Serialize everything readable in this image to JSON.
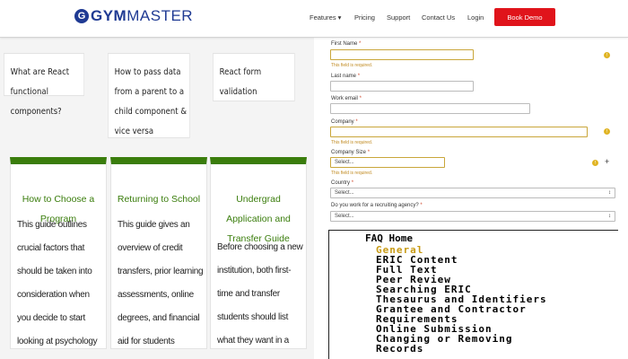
{
  "header": {
    "logo_gym": "GYM",
    "logo_master": "MASTER",
    "nav": {
      "features": "Features ▾",
      "pricing": "Pricing",
      "support": "Support",
      "contact": "Contact Us",
      "login": "Login"
    },
    "book_demo": "Book Demo",
    "colors": {
      "brand": "#1f3a93",
      "cta": "#e0141b"
    }
  },
  "questions": [
    "What are React functional components?",
    "How to pass data from a parent to a child component & vice versa",
    "React form validation"
  ],
  "guides": [
    {
      "title": "How to Choose a Program",
      "body": "This guide outlines crucial factors that should be taken into consideration when you decide to start looking at psychology programs."
    },
    {
      "title": "Returning to School",
      "body": "This guide gives an overview of credit transfers, prior learning assessments, online degrees, and financial aid for students returning to school."
    },
    {
      "title": "Undergrad Application and Transfer Guide",
      "body": "Before choosing a new institution, both first-time and transfer students should list what they want in a school"
    }
  ],
  "form": {
    "first_name": {
      "label": "First Name",
      "error": "This field is required."
    },
    "last_name": {
      "label": "Last name"
    },
    "work_email": {
      "label": "Work email"
    },
    "company": {
      "label": "Company",
      "error": "This field is required."
    },
    "company_size": {
      "label": "Company Size",
      "value": "Select...",
      "error": "This field is required."
    },
    "country": {
      "label": "Country",
      "value": "Select..."
    },
    "recruiting_agency": {
      "label": "Do you work for a recruiting agency?",
      "value": "Select..."
    },
    "required_mark": "*"
  },
  "faq": {
    "title": "FAQ Home",
    "items": [
      "General",
      "ERIC Content",
      "Full Text",
      "Peer Review",
      "Searching ERIC",
      "Thesaurus and Identifiers",
      "Grantee and Contractor",
      "Requirements",
      "Online Submission",
      "Changing or Removing",
      "Records"
    ],
    "active_color": "#c79a14"
  }
}
